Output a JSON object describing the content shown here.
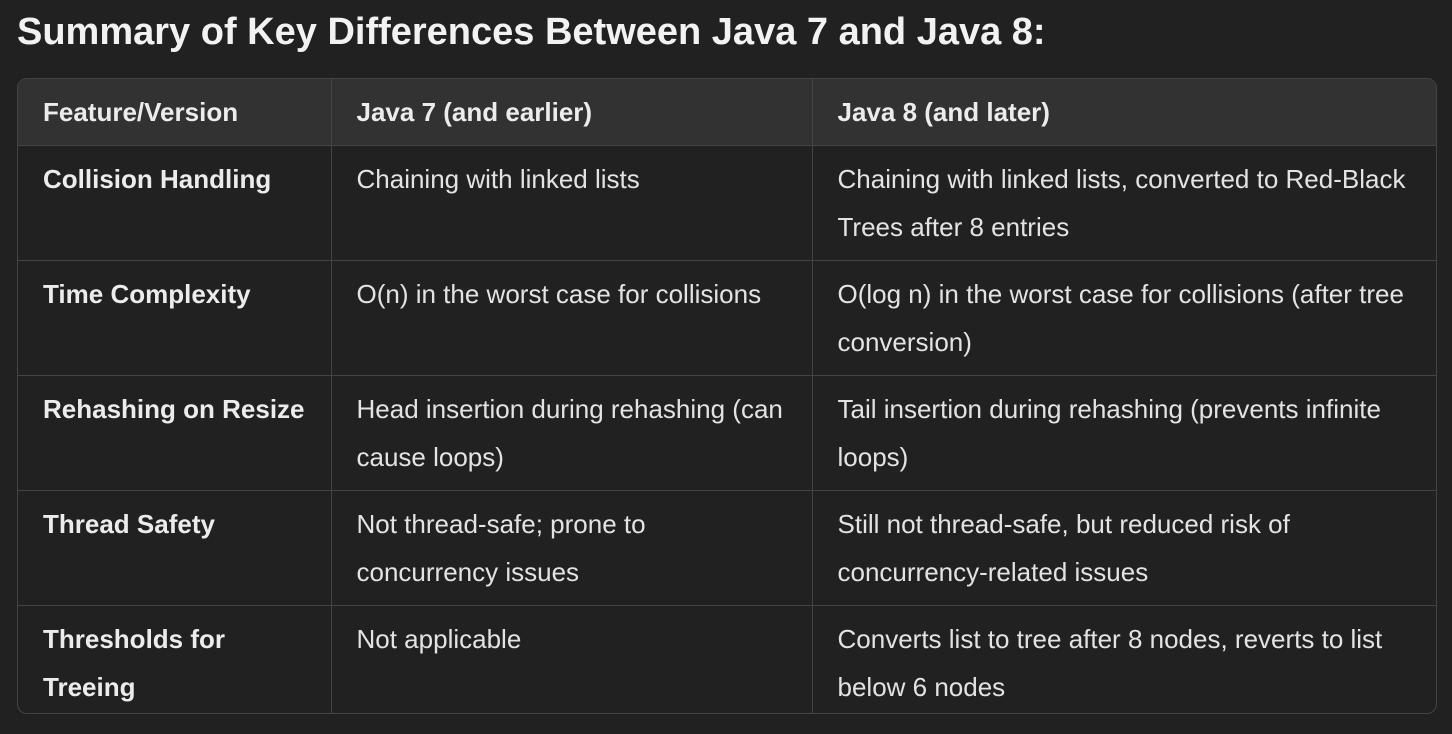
{
  "title": "Summary of Key Differences Between Java 7 and Java 8:",
  "table": {
    "headers": [
      "Feature/Version",
      "Java 7 (and earlier)",
      "Java 8 (and later)"
    ],
    "rows": [
      {
        "feature": "Collision Handling",
        "java7": "Chaining with linked lists",
        "java8": "Chaining with linked lists, converted to Red-Black Trees after 8 entries"
      },
      {
        "feature": "Time Complexity",
        "java7": "O(n) in the worst case for collisions",
        "java8": "O(log n) in the worst case for collisions (after tree conversion)"
      },
      {
        "feature": "Rehashing on Resize",
        "java7": "Head insertion during rehashing (can cause loops)",
        "java8": "Tail insertion during rehashing (prevents infinite loops)"
      },
      {
        "feature": "Thread Safety",
        "java7": "Not thread-safe; prone to concurrency issues",
        "java8": "Still not thread-safe, but reduced risk of concurrency-related issues"
      },
      {
        "feature": "Thresholds for Treeing",
        "java7": "Not applicable",
        "java8": "Converts list to tree after 8 nodes, reverts to list below 6 nodes"
      }
    ]
  },
  "colors": {
    "background": "#212121",
    "header_background": "#323232",
    "border": "#444444",
    "text": "#ececec"
  }
}
